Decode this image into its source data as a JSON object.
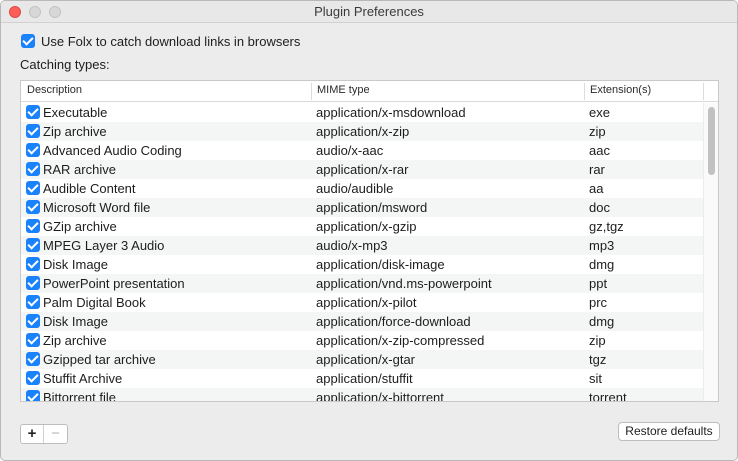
{
  "window": {
    "title": "Plugin Preferences"
  },
  "main_checkbox": {
    "label": "Use Folx to catch download links in browsers",
    "checked": true
  },
  "section_label": "Catching types:",
  "table": {
    "headers": {
      "description": "Description",
      "mime": "MIME type",
      "ext": "Extension(s)"
    },
    "rows": [
      {
        "description": "Executable",
        "mime": "application/x-msdownload",
        "ext": "exe",
        "checked": true
      },
      {
        "description": "Zip archive",
        "mime": "application/x-zip",
        "ext": "zip",
        "checked": true
      },
      {
        "description": "Advanced Audio Coding",
        "mime": "audio/x-aac",
        "ext": "aac",
        "checked": true
      },
      {
        "description": "RAR archive",
        "mime": "application/x-rar",
        "ext": "rar",
        "checked": true
      },
      {
        "description": "Audible Content",
        "mime": "audio/audible",
        "ext": "aa",
        "checked": true
      },
      {
        "description": "Microsoft Word file",
        "mime": "application/msword",
        "ext": "doc",
        "checked": true
      },
      {
        "description": "GZip archive",
        "mime": "application/x-gzip",
        "ext": "gz,tgz",
        "checked": true
      },
      {
        "description": "MPEG Layer 3 Audio",
        "mime": "audio/x-mp3",
        "ext": "mp3",
        "checked": true
      },
      {
        "description": "Disk Image",
        "mime": "application/disk-image",
        "ext": "dmg",
        "checked": true
      },
      {
        "description": "PowerPoint presentation",
        "mime": "application/vnd.ms-powerpoint",
        "ext": "ppt",
        "checked": true
      },
      {
        "description": "Palm Digital Book",
        "mime": "application/x-pilot",
        "ext": "prc",
        "checked": true
      },
      {
        "description": "Disk Image",
        "mime": "application/force-download",
        "ext": "dmg",
        "checked": true
      },
      {
        "description": "Zip archive",
        "mime": "application/x-zip-compressed",
        "ext": "zip",
        "checked": true
      },
      {
        "description": "Gzipped tar archive",
        "mime": "application/x-gtar",
        "ext": "tgz",
        "checked": true
      },
      {
        "description": "Stuffit Archive",
        "mime": "application/stuffit",
        "ext": "sit",
        "checked": true
      },
      {
        "description": "Bittorrent file",
        "mime": "application/x-bittorrent",
        "ext": "torrent",
        "checked": true
      }
    ]
  },
  "buttons": {
    "add": "+",
    "remove": "−",
    "restore": "Restore defaults"
  },
  "colors": {
    "accent": "#1a82fb",
    "close": "#fc5f57"
  }
}
